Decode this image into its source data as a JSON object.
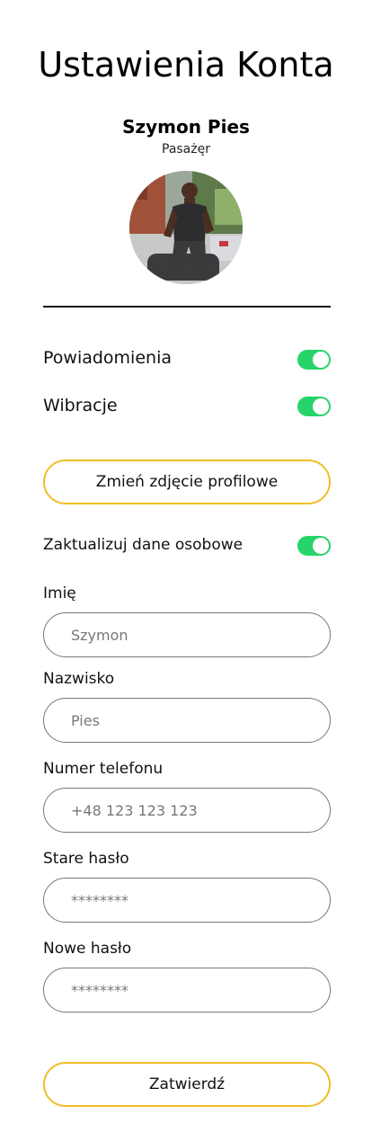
{
  "header": {
    "title": "Ustawienia Konta"
  },
  "profile": {
    "name": "Szymon Pies",
    "role": "Pasażęr"
  },
  "settings": [
    {
      "label": "Powiadomienia",
      "enabled": true
    },
    {
      "label": "Wibracje",
      "enabled": true
    }
  ],
  "change_photo_button": "Zmień zdjęcie profilowe",
  "update_personal": {
    "label": "Zaktualizuj dane osobowe",
    "enabled": true
  },
  "form": {
    "first_name": {
      "label": "Imię",
      "value": "Szymon"
    },
    "last_name": {
      "label": "Nazwisko",
      "value": "Pies"
    },
    "phone": {
      "label": "Numer telefonu",
      "value": "+48 123 123 123"
    },
    "old_password": {
      "label": "Stare hasło",
      "value": "********"
    },
    "new_password": {
      "label": "Nowe hasło",
      "value": "********"
    }
  },
  "submit_button": "Zatwierdź",
  "colors": {
    "accent": "#f0be27",
    "toggle_on": "#27d46a"
  }
}
